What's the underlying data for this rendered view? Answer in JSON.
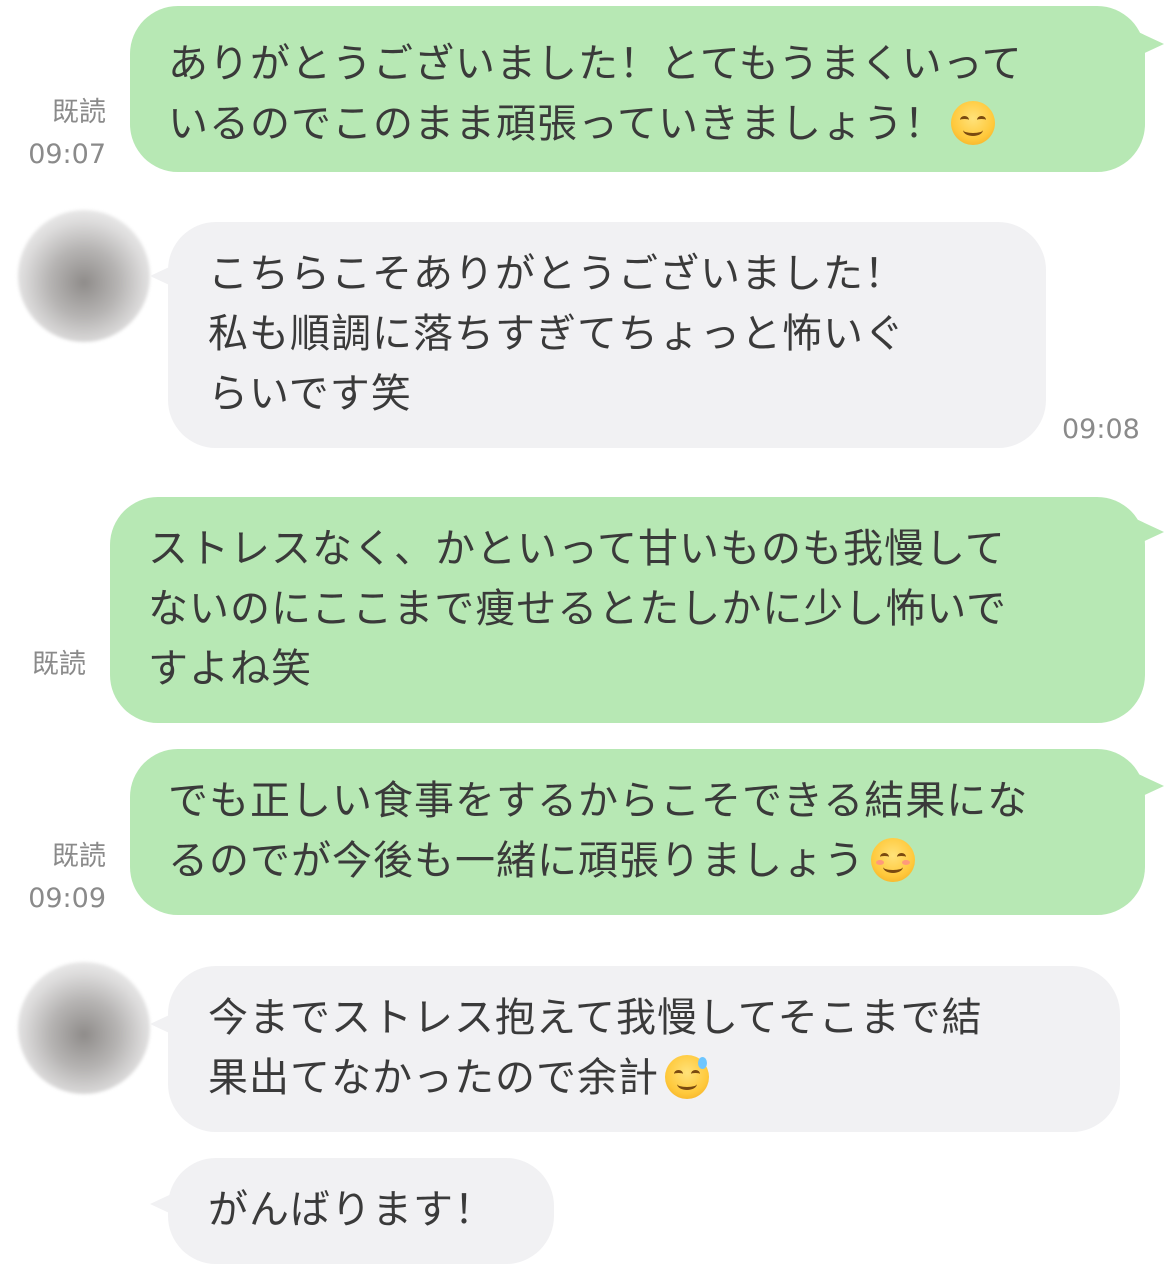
{
  "messages": [
    {
      "side": "sent",
      "lines": [
        "ありがとうございました！とてもうまくいって",
        "いるのでこのまま頑張っていきましょう！"
      ],
      "emoji": "smiling-face-icon",
      "read_label": "既読",
      "time": "09:07"
    },
    {
      "side": "received",
      "lines": [
        "こちらこそありがとうございました！",
        "私も順調に落ちすぎてちょっと怖いぐ",
        "らいです笑"
      ],
      "time": "09:08"
    },
    {
      "side": "sent",
      "lines": [
        "ストレスなく、かといって甘いものも我慢して",
        "ないのにここまで痩せるとたしかに少し怖いで",
        "すよね笑"
      ],
      "read_label": "既読"
    },
    {
      "side": "sent",
      "lines": [
        "でも正しい食事をするからこそできる結果にな",
        "るのでが今後も一緒に頑張りましょう"
      ],
      "emoji": "relaxed-face-icon",
      "read_label": "既読",
      "time": "09:09"
    },
    {
      "side": "received",
      "lines": [
        "今までストレス抱えて我慢してそこまで結",
        "果出てなかったので余計"
      ],
      "emoji": "grinning-sweat-face-icon"
    },
    {
      "side": "received",
      "lines": [
        "がんばります！"
      ]
    }
  ]
}
